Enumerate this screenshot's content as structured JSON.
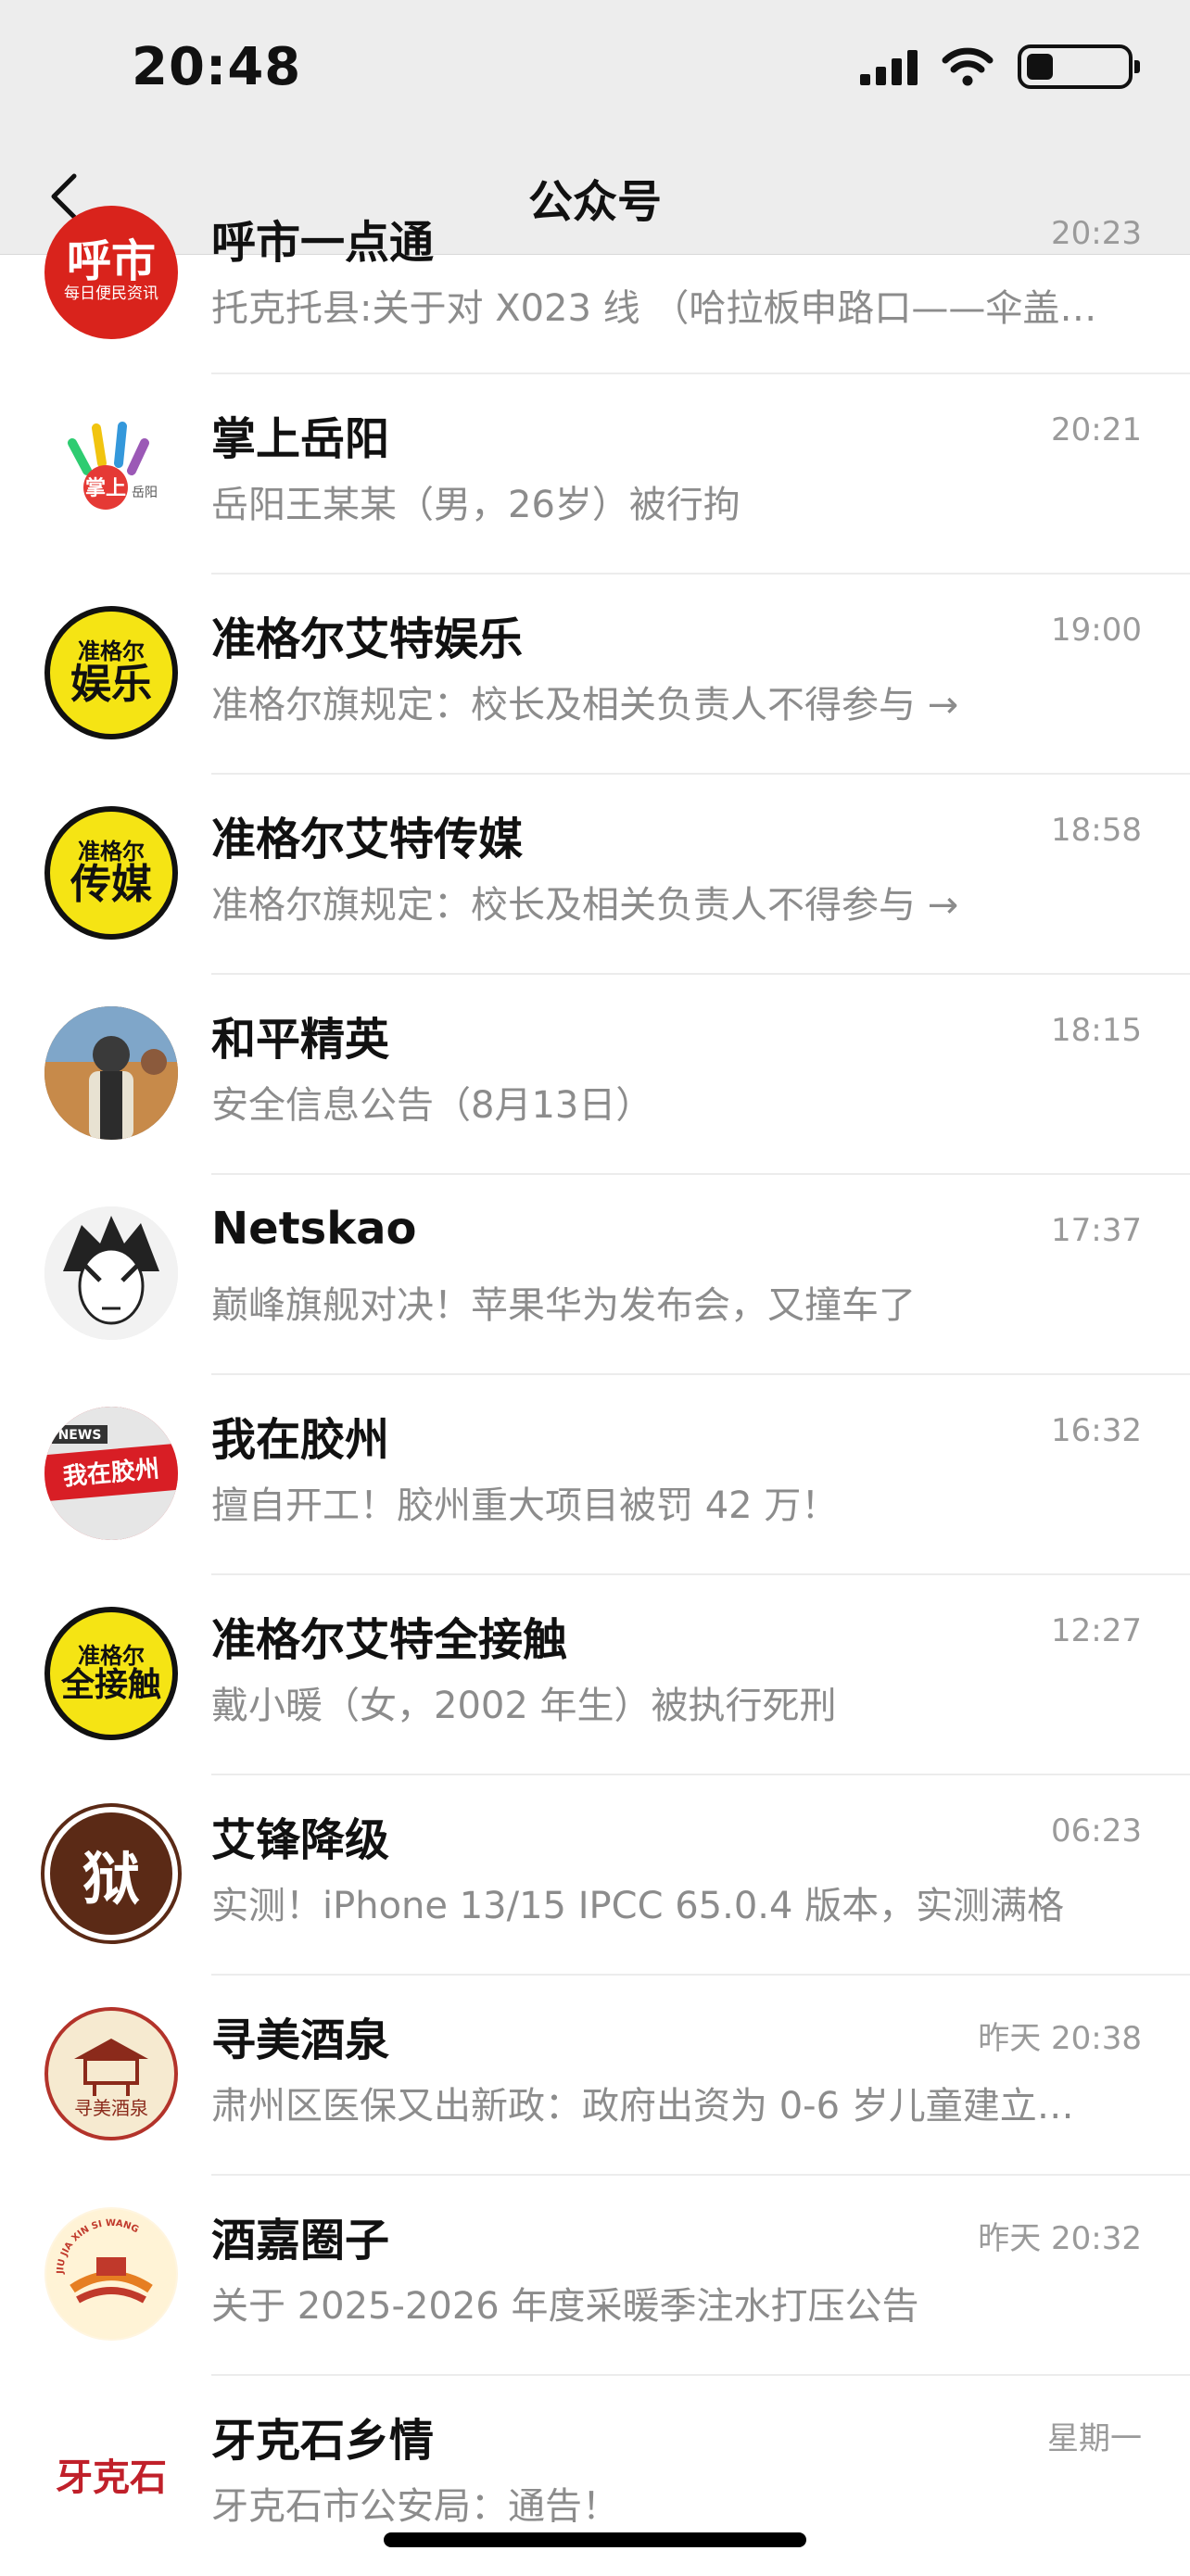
{
  "status": {
    "time": "20:48"
  },
  "header": {
    "title": "公众号"
  },
  "items": [
    {
      "name": "呼市一点通",
      "time": "20:23",
      "preview": "托克托县:关于对 X023 线 （哈拉板申路口——伞盖…",
      "avatar_text": "呼市",
      "avatar_sub": "每日便民资讯"
    },
    {
      "name": "掌上岳阳",
      "time": "20:21",
      "preview": "岳阳王某某（男，26岁）被行拘",
      "avatar_text": "掌上",
      "avatar_sub": "岳阳"
    },
    {
      "name": "准格尔艾特娱乐",
      "time": "19:00",
      "preview": "准格尔旗规定：校长及相关负责人不得参与 →",
      "avatar_text": "准格尔",
      "avatar_sub": "娱乐"
    },
    {
      "name": "准格尔艾特传媒",
      "time": "18:58",
      "preview": "准格尔旗规定：校长及相关负责人不得参与 →",
      "avatar_text": "准格尔",
      "avatar_sub": "传媒"
    },
    {
      "name": "和平精英",
      "time": "18:15",
      "preview": "安全信息公告（8月13日）"
    },
    {
      "name": "Netskao",
      "time": "17:37",
      "preview": "巅峰旗舰对决！苹果华为发布会，又撞车了"
    },
    {
      "name": "我在胶州",
      "time": "16:32",
      "preview": "擅自开工！胶州重大项目被罚 42 万！",
      "avatar_text": "我在胶州",
      "avatar_sub": "NEWS"
    },
    {
      "name": "准格尔艾特全接触",
      "time": "12:27",
      "preview": "戴小暖（女，2002 年生）被执行死刑",
      "avatar_text": "准格尔",
      "avatar_sub": "全接触"
    },
    {
      "name": "艾锋降级",
      "time": "06:23",
      "preview": "实测！iPhone 13/15 IPCC 65.0.4 版本，实测满格",
      "avatar_text": "狱"
    },
    {
      "name": "寻美酒泉",
      "time": "昨天 20:38",
      "preview": "肃州区医保又出新政：政府出资为 0-6 岁儿童建立…",
      "avatar_text": "寻美酒泉"
    },
    {
      "name": "酒嘉圈子",
      "time": "昨天 20:32",
      "preview": "关于 2025-2026 年度采暖季注水打压公告",
      "avatar_text": "JIU JIA XIN SI WANG"
    },
    {
      "name": "牙克石乡情",
      "time": "星期一",
      "preview": "牙克石市公安局：通告！",
      "avatar_text": "牙克石"
    }
  ]
}
